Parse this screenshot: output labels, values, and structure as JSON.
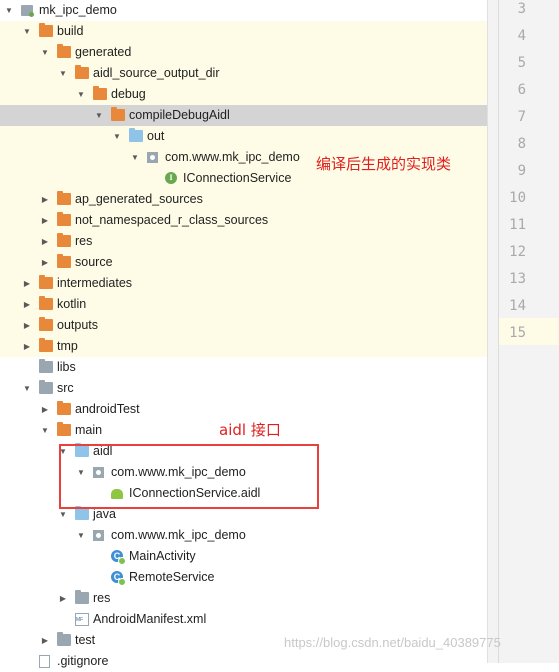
{
  "tree": {
    "rows": [
      {
        "label": "mk_ipc_demo",
        "arrow": "down",
        "icon": "module-icon"
      },
      {
        "label": "build",
        "arrow": "down",
        "icon": "folder-icon"
      },
      {
        "label": "generated",
        "arrow": "down",
        "icon": "folder-icon"
      },
      {
        "label": "aidl_source_output_dir",
        "arrow": "down",
        "icon": "folder-icon"
      },
      {
        "label": "debug",
        "arrow": "down",
        "icon": "folder-icon"
      },
      {
        "label": "compileDebugAidl",
        "arrow": "down",
        "icon": "folder-icon",
        "selected": true
      },
      {
        "label": "out",
        "arrow": "down",
        "icon": "source-folder-icon"
      },
      {
        "label": "com.www.mk_ipc_demo",
        "arrow": "down",
        "icon": "package-icon"
      },
      {
        "label": "IConnectionService",
        "arrow": "",
        "icon": "interface-icon"
      },
      {
        "label": "ap_generated_sources",
        "arrow": "right",
        "icon": "folder-icon"
      },
      {
        "label": "not_namespaced_r_class_sources",
        "arrow": "right",
        "icon": "folder-icon"
      },
      {
        "label": "res",
        "arrow": "right",
        "icon": "folder-icon"
      },
      {
        "label": "source",
        "arrow": "right",
        "icon": "folder-icon"
      },
      {
        "label": "intermediates",
        "arrow": "right",
        "icon": "folder-icon"
      },
      {
        "label": "kotlin",
        "arrow": "right",
        "icon": "folder-icon"
      },
      {
        "label": "outputs",
        "arrow": "right",
        "icon": "folder-icon"
      },
      {
        "label": "tmp",
        "arrow": "right",
        "icon": "folder-icon"
      },
      {
        "label": "libs",
        "arrow": "",
        "icon": "folder-icon"
      },
      {
        "label": "src",
        "arrow": "down",
        "icon": "folder-icon"
      },
      {
        "label": "androidTest",
        "arrow": "right",
        "icon": "folder-icon"
      },
      {
        "label": "main",
        "arrow": "down",
        "icon": "folder-icon"
      },
      {
        "label": "aidl",
        "arrow": "down",
        "icon": "source-folder-icon"
      },
      {
        "label": "com.www.mk_ipc_demo",
        "arrow": "down",
        "icon": "package-icon"
      },
      {
        "label": "IConnectionService.aidl",
        "arrow": "",
        "icon": "android-icon"
      },
      {
        "label": "java",
        "arrow": "down",
        "icon": "source-folder-icon"
      },
      {
        "label": "com.www.mk_ipc_demo",
        "arrow": "down",
        "icon": "package-icon"
      },
      {
        "label": "MainActivity",
        "arrow": "",
        "icon": "class-icon"
      },
      {
        "label": "RemoteService",
        "arrow": "",
        "icon": "class-icon"
      },
      {
        "label": "res",
        "arrow": "right",
        "icon": "resource-folder-icon"
      },
      {
        "label": "AndroidManifest.xml",
        "arrow": "",
        "icon": "manifest-icon"
      },
      {
        "label": "test",
        "arrow": "right",
        "icon": "folder-icon"
      },
      {
        "label": ".gitignore",
        "arrow": "",
        "icon": "file-icon"
      }
    ]
  },
  "gutter": {
    "line_numbers": [
      "3",
      "4",
      "5",
      "6",
      "7",
      "8",
      "9",
      "10",
      "11",
      "12",
      "13",
      "14",
      "15"
    ]
  },
  "annotations": {
    "generated_note": "编译后生成的实现类",
    "aidl_note": "aidl 接口"
  },
  "watermark": "https://blog.csdn.net/baidu_40389775",
  "colors": {
    "highlight": "#fefce6",
    "selected": "#d4d4d4",
    "annotation": "#e02020",
    "folder": "#e8883a"
  }
}
